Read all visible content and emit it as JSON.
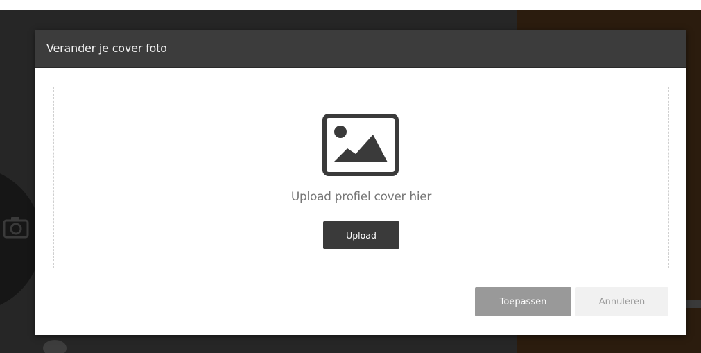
{
  "modal": {
    "title": "Verander je cover foto",
    "dropzone": {
      "icon": "image-icon",
      "hint": "Upload profiel cover hier",
      "upload_label": "Upload"
    },
    "footer": {
      "apply_label": "Toepassen",
      "cancel_label": "Annuleren"
    }
  },
  "background": {
    "icons": [
      "camera-icon"
    ]
  },
  "colors": {
    "header_bg": "#3c3c3c",
    "backdrop": "#262626",
    "backdrop_right": "#2b1c0e",
    "upload_button": "#3a3a3a",
    "apply_button": "#999999",
    "cancel_button": "#f1f1f1"
  }
}
